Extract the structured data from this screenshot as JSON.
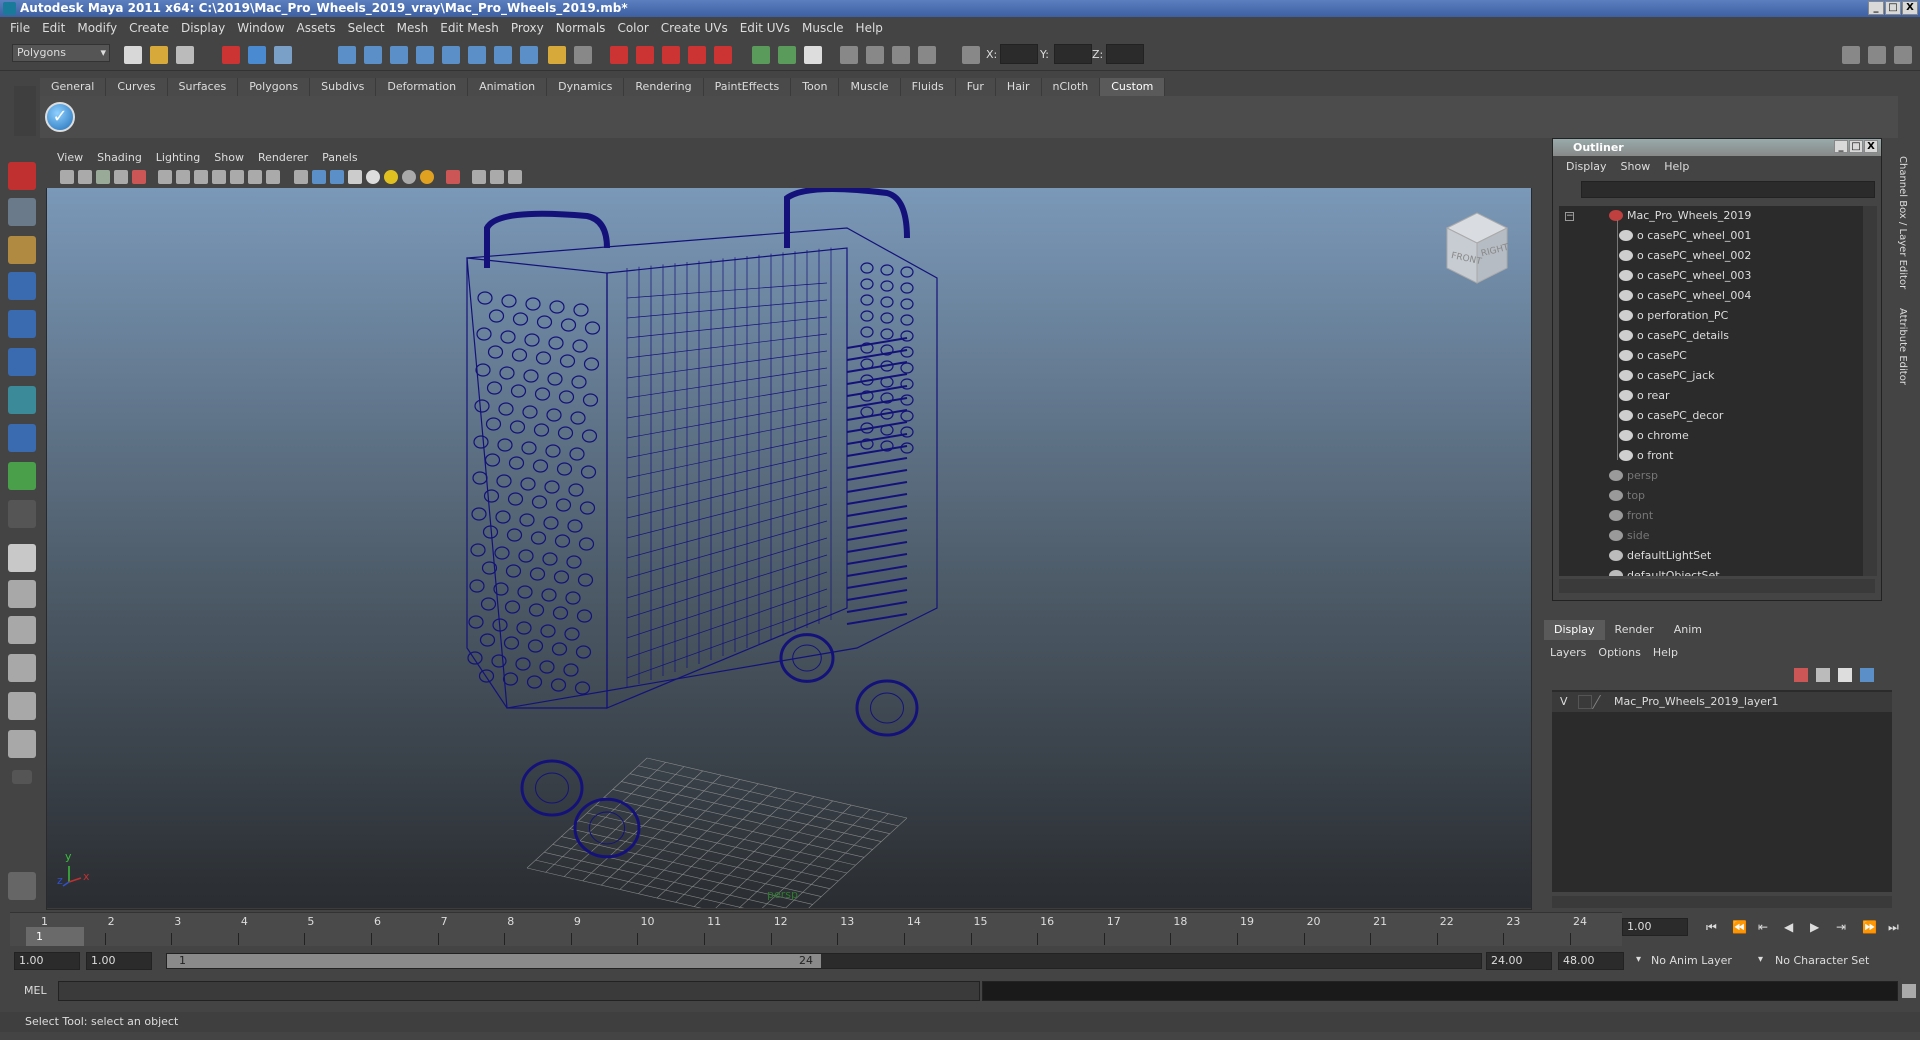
{
  "window": {
    "title": "Autodesk Maya 2011 x64: C:\\2019\\Mac_Pro_Wheels_2019_vray\\Mac_Pro_Wheels_2019.mb*",
    "minimize": "_",
    "maximize": "□",
    "close": "X"
  },
  "menubar": [
    "File",
    "Edit",
    "Modify",
    "Create",
    "Display",
    "Window",
    "Assets",
    "Select",
    "Mesh",
    "Edit Mesh",
    "Proxy",
    "Normals",
    "Color",
    "Create UVs",
    "Edit UVs",
    "Muscle",
    "Help"
  ],
  "statusline": {
    "mode": "Polygons",
    "x_label": "X:",
    "y_label": "Y:",
    "z_label": "Z:"
  },
  "shelf": {
    "tabs": [
      "General",
      "Curves",
      "Surfaces",
      "Polygons",
      "Subdivs",
      "Deformation",
      "Animation",
      "Dynamics",
      "Rendering",
      "PaintEffects",
      "Toon",
      "Muscle",
      "Fluids",
      "Fur",
      "Hair",
      "nCloth",
      "Custom"
    ],
    "active_tab": "Custom",
    "check_glyph": "✓"
  },
  "panel": {
    "menus": [
      "View",
      "Shading",
      "Lighting",
      "Show",
      "Renderer",
      "Panels"
    ],
    "camera_label": "persp",
    "axis_y": "y",
    "axis_x": "x",
    "axis_z": "z",
    "viewcube_front": "FRONT",
    "viewcube_right": "RIGHT",
    "wire_color": "#14127a"
  },
  "outliner": {
    "title": "Outliner",
    "menus": [
      "Display",
      "Show",
      "Help"
    ],
    "root": "Mac_Pro_Wheels_2019",
    "children": [
      "casePC_wheel_001",
      "casePC_wheel_002",
      "casePC_wheel_003",
      "casePC_wheel_004",
      "perforation_PC",
      "casePC_details",
      "casePC",
      "casePC_jack",
      "rear",
      "casePC_decor",
      "chrome",
      "front"
    ],
    "cameras": [
      "persp",
      "top",
      "front",
      "side"
    ],
    "sets": [
      "defaultLightSet",
      "defaultObjectSet"
    ]
  },
  "layers": {
    "tabs": [
      "Display",
      "Render",
      "Anim"
    ],
    "active_tab": "Display",
    "menus": [
      "Layers",
      "Options",
      "Help"
    ],
    "rows": [
      {
        "visible": "V",
        "name": "Mac_Pro_Wheels_2019_layer1"
      }
    ]
  },
  "timeline": {
    "ticks": [
      "1",
      "2",
      "3",
      "4",
      "5",
      "6",
      "7",
      "8",
      "9",
      "10",
      "11",
      "12",
      "13",
      "14",
      "15",
      "16",
      "17",
      "18",
      "19",
      "20",
      "21",
      "22",
      "23",
      "24"
    ],
    "current_frame_marker": "1",
    "current_frame": "1.00"
  },
  "range": {
    "start": "1.00",
    "playback_start": "1.00",
    "handle_start": "1",
    "handle_end": "24",
    "playback_end": "24.00",
    "end": "48.00",
    "anim_layer": "No Anim Layer",
    "character_set": "No Character Set"
  },
  "command": {
    "label": "MEL"
  },
  "helpline": {
    "text": "Select Tool: select an object"
  },
  "side_tabs": [
    "Channel Box / Layer Editor",
    "Attribute Editor"
  ]
}
